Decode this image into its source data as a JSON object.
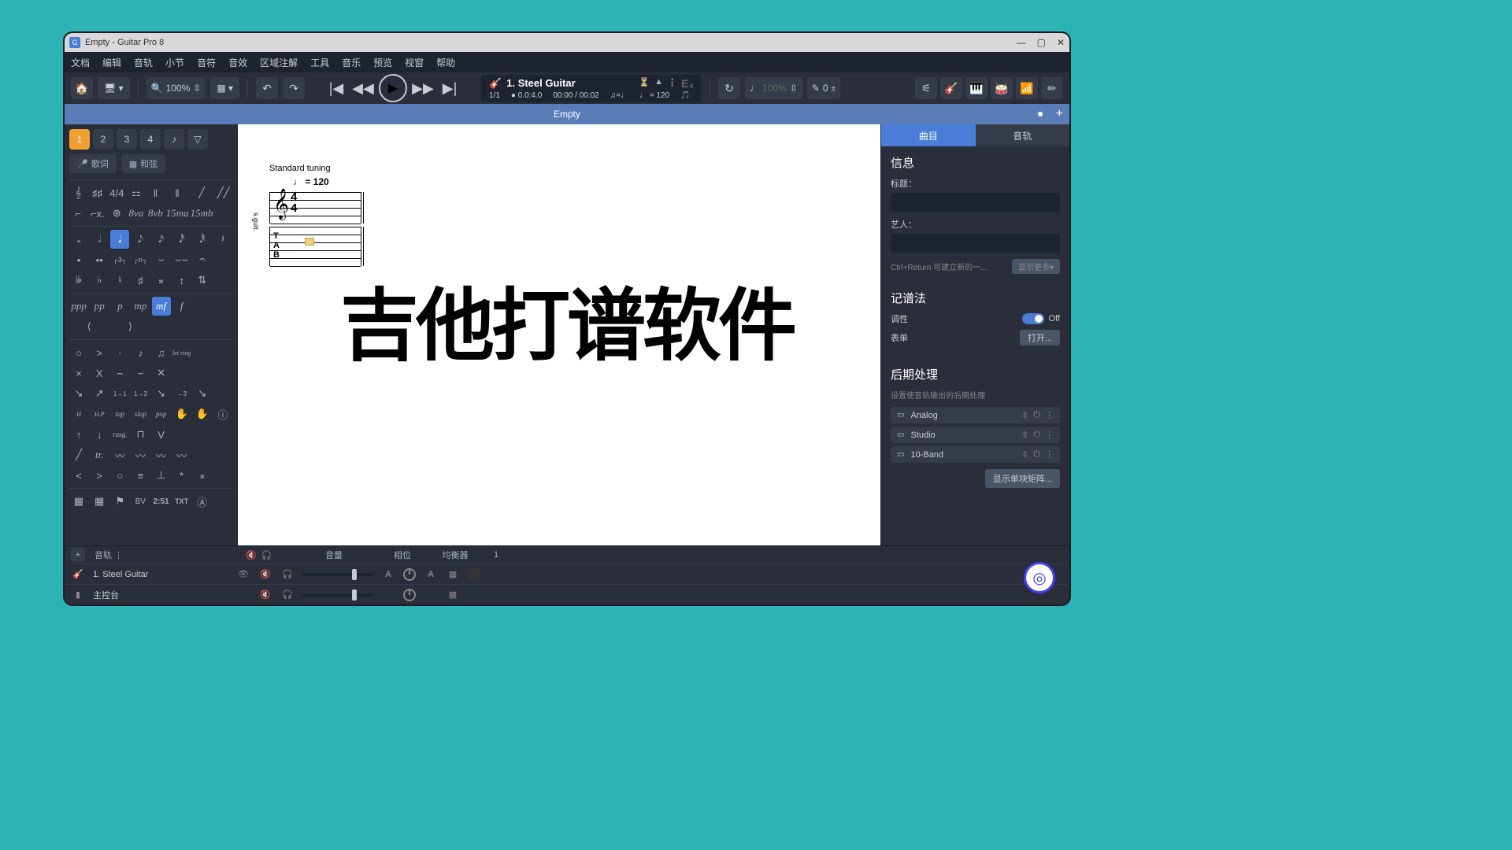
{
  "titlebar": {
    "title": "Empty - Guitar Pro 8"
  },
  "menu": [
    "文档",
    "编辑",
    "音轨",
    "小节",
    "音符",
    "音效",
    "区域注解",
    "工具",
    "音乐",
    "预览",
    "视窗",
    "帮助"
  ],
  "zoom": "100%",
  "swing": "100%",
  "transpose": "0",
  "track": {
    "name": "1. Steel Guitar",
    "bars": "1/1",
    "cursor": "0.0:4.0",
    "time": "00:00 / 00:02",
    "tempo": "♩ = 120",
    "tuning": "E₄"
  },
  "tab": {
    "name": "Empty"
  },
  "voices": [
    "1",
    "2",
    "3",
    "4"
  ],
  "lyrics_btn": "歌词",
  "chord_btn": "和弦",
  "noterow": [
    "𝅝",
    "𝅗𝅥",
    "𝅘𝅥",
    "𝅘𝅥𝅮",
    "𝅘𝅥𝅯",
    "𝅘𝅥𝅰",
    "𝅘𝅥𝅱",
    "𝄽"
  ],
  "dynrow": [
    "ppp",
    "pp",
    "p",
    "mp",
    "mf",
    "f"
  ],
  "score": {
    "tuning": "Standard tuning",
    "tempo": "♩ = 120",
    "label": "s.guit."
  },
  "inspector": {
    "tabs": [
      "曲目",
      "音轨"
    ],
    "info_hdr": "信息",
    "title_lbl": "标题：",
    "artist_lbl": "艺人：",
    "hint": "Ctrl+Return 可建立新的一…",
    "showmore": "显示更多▾",
    "notation_hdr": "记谱法",
    "transpose_lbl": "调性",
    "off": "Off",
    "form_lbl": "表单",
    "open": "打开...",
    "fx_hdr": "后期处理",
    "fx_sub": "设置使音轨输出的后期处理",
    "fx": [
      "Analog",
      "Studio",
      "10-Band"
    ],
    "matrix": "显示单块矩阵..."
  },
  "mixer": {
    "hdr_track": "音轨",
    "hdr_vol": "音量",
    "hdr_pan": "相位",
    "hdr_eq": "均衡器",
    "rows": [
      {
        "num": "1.",
        "name": "Steel Guitar"
      },
      {
        "num": "",
        "name": "主控台"
      }
    ]
  },
  "overlay": "吉他打谱软件"
}
